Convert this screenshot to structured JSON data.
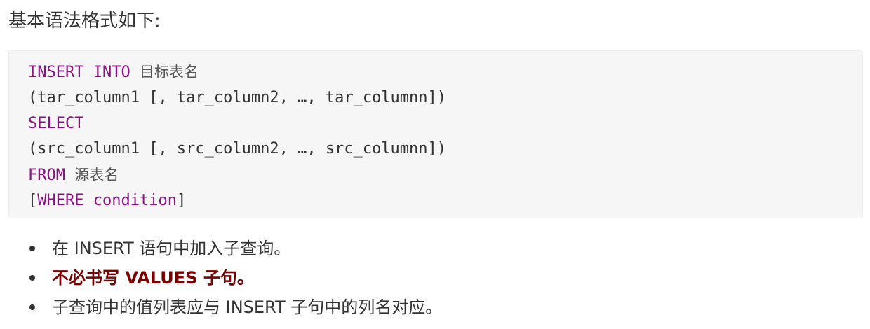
{
  "intro": "基本语法格式如下:",
  "code": {
    "line1": {
      "kw1": "INSERT",
      "kw2": "INTO",
      "text": "目标表名"
    },
    "line2": "(tar_column1 [, tar_column2, …, tar_columnn])",
    "line3": {
      "kw": "SELECT"
    },
    "line4": "(src_column1 [, src_column2, …, src_columnn])",
    "line5": {
      "kw": "FROM",
      "text": "源表名"
    },
    "line6": {
      "open": "[",
      "kw": "WHERE",
      "kw2": "condition",
      "close": "]"
    }
  },
  "bullets": [
    "在 INSERT 语句中加入子查询。",
    "不必书写 VALUES 子句。",
    "子查询中的值列表应与 INSERT 子句中的列名对应。"
  ],
  "colors": {
    "keyword": "#881280",
    "emphasis": "#7a0000",
    "code_bg": "#f6f6f6"
  }
}
